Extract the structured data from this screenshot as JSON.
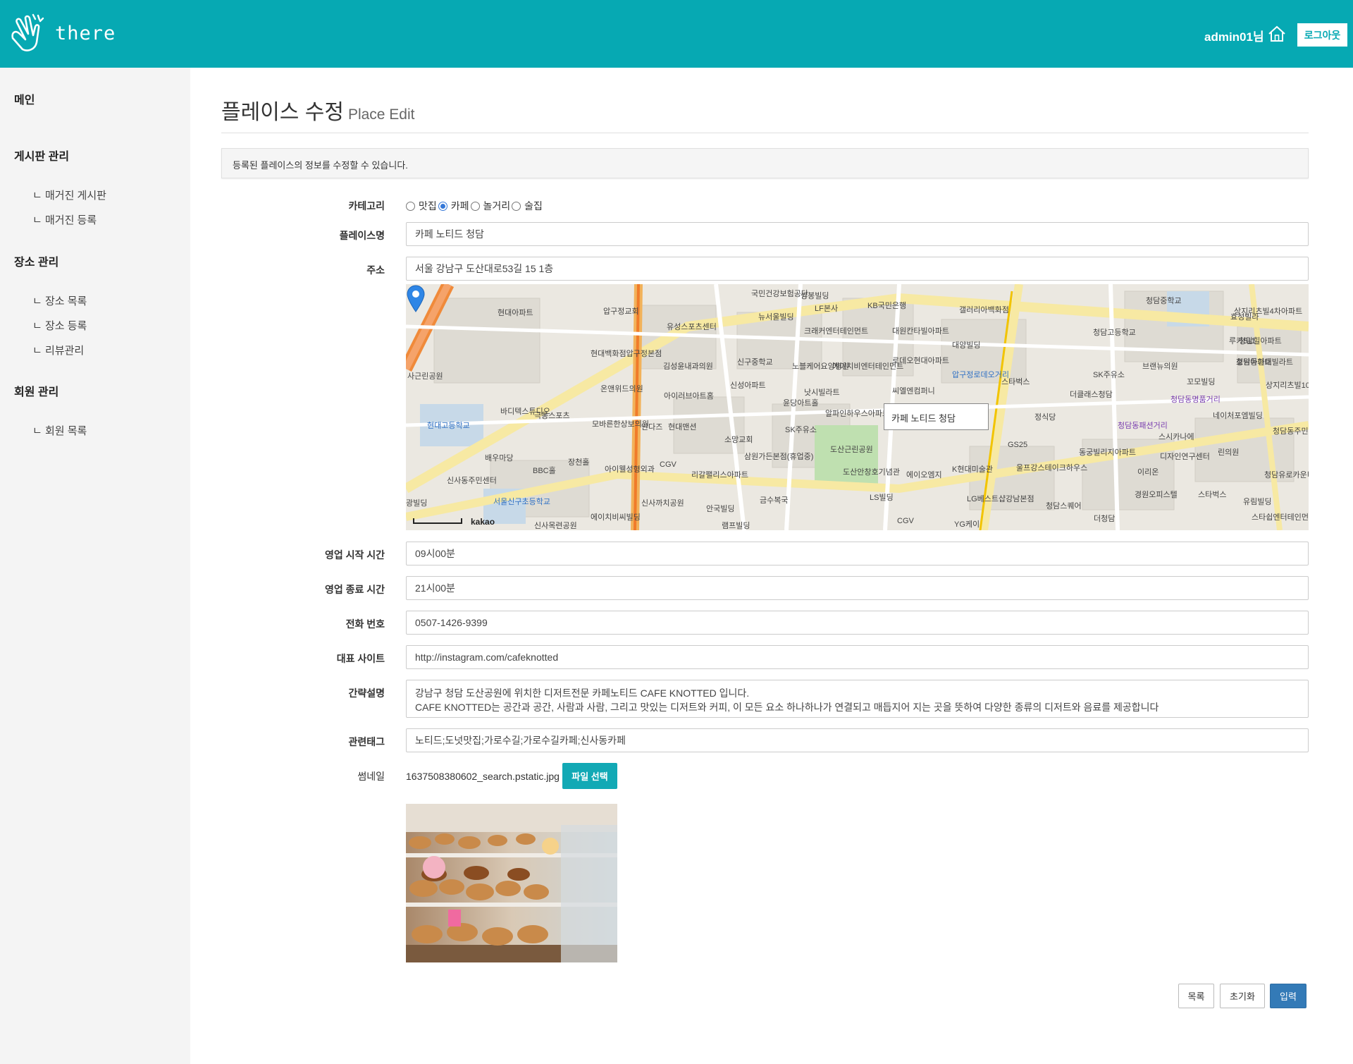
{
  "header": {
    "logo_text": "there",
    "user_name": "admin01님",
    "logout_label": "로그아웃"
  },
  "sidebar": {
    "sections": [
      {
        "label": "메인",
        "items": []
      },
      {
        "label": "게시판 관리",
        "items": [
          "ㄴ 매거진 게시판",
          "ㄴ 매거진 등록"
        ]
      },
      {
        "label": "장소 관리",
        "items": [
          "ㄴ 장소 목록",
          "ㄴ 장소 등록",
          "ㄴ 리뷰관리"
        ]
      },
      {
        "label": "회원 관리",
        "items": [
          "ㄴ 회원 목록"
        ]
      }
    ]
  },
  "page": {
    "title": "플레이스 수정",
    "subtitle": "Place Edit",
    "info": "등록된 플레이스의 정보를 수정할 수 있습니다."
  },
  "form": {
    "category": {
      "label": "카테고리",
      "options": [
        "맛집",
        "카페",
        "놀거리",
        "술집"
      ],
      "selected": "카페"
    },
    "name": {
      "label": "플레이스명",
      "value": "카페 노티드 청담"
    },
    "address": {
      "label": "주소",
      "value": "서울 강남구 도산대로53길 15 1층"
    },
    "open_time": {
      "label": "영업 시작 시간",
      "value": "09시00분"
    },
    "close_time": {
      "label": "영업 종료 시간",
      "value": "21시00분"
    },
    "phone": {
      "label": "전화 번호",
      "value": "0507-1426-9399"
    },
    "site": {
      "label": "대표 사이트",
      "value": "http://instagram.com/cafeknotted"
    },
    "description": {
      "label": "간략설명",
      "line1": "강남구 청담 도산공원에 위치한 디저트전문 카페노티드 CAFE KNOTTED 입니다.",
      "line2": "CAFE KNOTTED는 공간과 공간, 사람과 사람, 그리고 맛있는 디저트와 커피, 이 모든 요소 하나하나가 연결되고 매듭지어 지는 곳을 뜻하여 다양한 종류의 디저트와 음료를 제공합니다"
    },
    "tags": {
      "label": "관련태그",
      "value": "노티드;도넛맛집;가로수길;가로수길카페;신사동카페"
    },
    "thumbnail": {
      "label": "썸네일",
      "file_name": "1637508380602_search.pstatic.jpg",
      "button_label": "파일 선택"
    }
  },
  "map": {
    "tooltip": "카페 노티드 청담",
    "brand": "kakao",
    "labels": [
      "현대아파트",
      "압구정교회",
      "유성스포츠센터",
      "신구중학교",
      "신성아파트",
      "국민건강보험공단",
      "뉴서울빌딩",
      "쌍봉빌딩",
      "LF본사",
      "KB국민은행",
      "크래커엔터테인먼트",
      "대원칸타빌아파트",
      "대양빌딩",
      "갤러리아백화점",
      "청담중학교",
      "청담고등학교",
      "효성빌라",
      "루카511",
      "로데오현대아파트",
      "에이치비엔터테인먼트",
      "압구정로데오거리",
      "스타벅스",
      "SK주유소",
      "브랜뉴의원",
      "호원아파트",
      "청담동명품거리",
      "현대백화점압구정본점",
      "김성윤내과의원",
      "노블케어요양병원",
      "낫시빌라트",
      "씨엘엔컴퍼니",
      "더클래스청담",
      "정식당",
      "청담동패션거리",
      "네이처포엠빌딩",
      "청담동주민센터",
      "사근린공원",
      "온앤위드의원",
      "아이러브아트홈",
      "윤당아트홀",
      "알파인하우스아파트",
      "바디텍스튜디오",
      "극동스포츠",
      "현대고등학교",
      "모바른한상보의원",
      "안다즈",
      "현대맨션",
      "소망교회",
      "SK주유소",
      "도산근린공원",
      "도산안창호기념관",
      "에이오엠지",
      "K현대미술관",
      "GS25",
      "동궁빌리지아파트",
      "디자인연구센터",
      "린의원",
      "배우마당",
      "BBC홀",
      "장천홀",
      "아이웰성형외과",
      "CGV",
      "리갈팰리스아파트",
      "삼원가든본점(휴업중)",
      "울프강스테이크하우스",
      "이리온",
      "신사동주민센터",
      "서울신구초등학교",
      "광빌딩",
      "신사까치공원",
      "안국빌딩",
      "금수복국",
      "LS빌딩",
      "LG베스트샵강남본점",
      "청담스퀘어",
      "경원오피스텔",
      "스타벅스",
      "유림빌딩",
      "신사목련공원",
      "에이치비씨빌딩",
      "램프빌딩",
      "CGV",
      "YG케이",
      "더청담",
      "스타쉽엔터테인먼트",
      "상지리츠빌4차아파트",
      "청담동현대빌라트",
      "꼬모빌딩",
      "상지리츠빌10차아파트",
      "청담힐아파트",
      "스시카나에",
      "청담유로카운티"
    ]
  },
  "buttons": {
    "list": "목록",
    "reset": "초기화",
    "submit": "입력"
  },
  "colors": {
    "header": "#06a9b3",
    "file_button": "#12a9b5",
    "submit": "#337ab7",
    "sidebar": "#f4f4f4"
  }
}
